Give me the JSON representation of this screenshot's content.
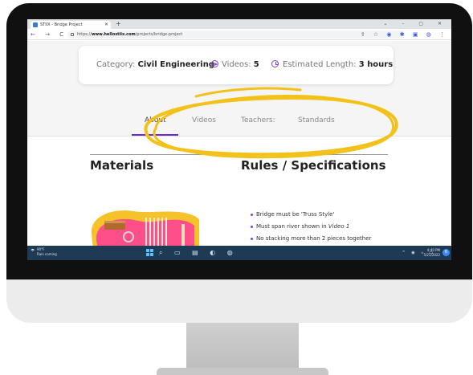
{
  "browser": {
    "tab_title": "STIIX - Bridge Project",
    "new_tab_label": "+",
    "window_controls": "⌄ – ▢ ✕",
    "nav_icons": "← → C",
    "url_prefix": "https://",
    "url_host": "www.hellostiix.com",
    "url_path": "/projects/bridge-project",
    "extension_icons": "⇪ ☆",
    "extension_icons_2": "◉ ✱ ▣ ◍ ⋮"
  },
  "project": {
    "category_label": "Category: ",
    "category_value": "Civil Engineering",
    "videos_label": "Videos: ",
    "videos_value": "5",
    "length_label": "Estimated Length: ",
    "length_value": "3 hours"
  },
  "tabs": [
    {
      "label": "About"
    },
    {
      "label": "Videos"
    },
    {
      "label": "Teachers:"
    },
    {
      "label": "Standards"
    }
  ],
  "materials_heading": "Materials",
  "rules_heading": "Rules / Specifications",
  "rules": [
    {
      "before": "Bridge must be 'Truss Style'",
      "em": "",
      "after": ""
    },
    {
      "before": "Must span river shown in ",
      "em": "Video 1",
      "after": ""
    },
    {
      "before": "No stacking more than 2 pieces together",
      "em": "",
      "after": ""
    }
  ],
  "taskbar": {
    "temperature": "90°F",
    "weather_text": "Rain coming",
    "taskbar_icons": "⌕ ▭ ▤ ◐ ◍",
    "tray_icons": "^ ◉ ◃ ▭",
    "time": "4:40 PM",
    "date": "5/21/2022",
    "notification_count": "6"
  },
  "colors": {
    "accent": "#6a2bd8",
    "highlight": "#f2c21b",
    "bezel": "#101010"
  }
}
